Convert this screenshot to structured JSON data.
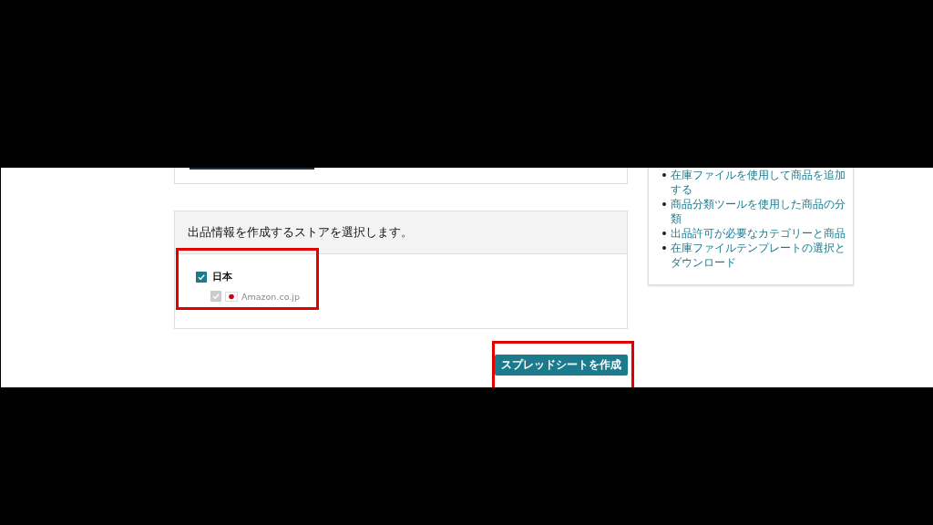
{
  "first_card": {
    "kind": "cut"
  },
  "store_panel": {
    "title": "出品情報を作成するストアを選択します。",
    "stores": [
      {
        "label": "日本",
        "checked": true,
        "disabled": false,
        "children": [
          {
            "label": "Amazon.co.jp",
            "checked": true,
            "disabled": true
          }
        ]
      }
    ]
  },
  "create_button": "スプレッドシートを作成",
  "help_links": [
    "在庫ファイルを使用して商品を追加する",
    "商品分類ツールを使用した商品の分類",
    "出品許可が必要なカテゴリーと商品",
    "在庫ファイルテンプレートの選択とダウンロード"
  ]
}
